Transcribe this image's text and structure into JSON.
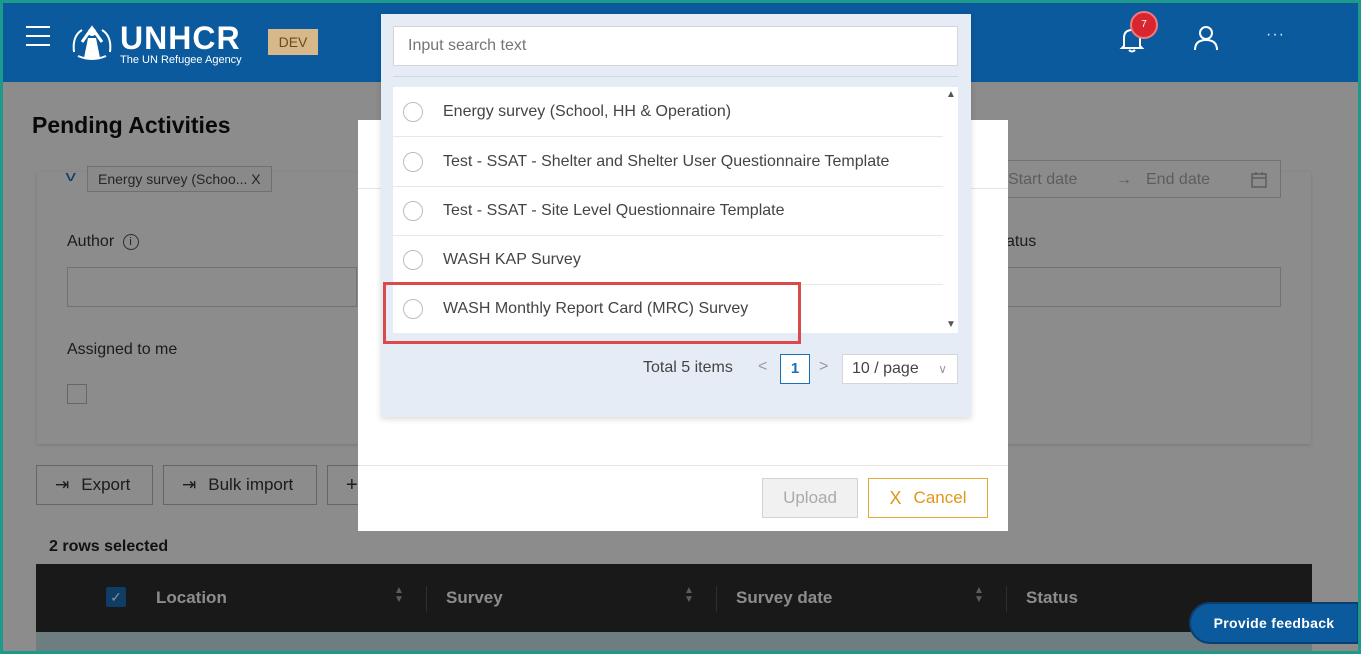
{
  "header": {
    "logo_name": "UNHCR",
    "logo_sub": "The UN Refugee Agency",
    "env_badge": "DEV",
    "notification_count": "7",
    "more_label": "···"
  },
  "page": {
    "title": "Pending Activities",
    "filter_tag": "Energy survey (Schoo...  X",
    "author_label": "Author",
    "status_label": "atus",
    "assigned_label": "Assigned to me",
    "start_date_placeholder": "Start date",
    "end_date_placeholder": "End date",
    "date_arrow": "→"
  },
  "toolbar": {
    "export_label": "Export",
    "bulk_import_label": "Bulk import",
    "add_label": "+"
  },
  "table": {
    "rows_selected": "2 rows selected",
    "columns": [
      "Location",
      "Survey",
      "Survey date",
      "Status"
    ]
  },
  "dropdown": {
    "search_placeholder": "Input search text",
    "items": [
      {
        "label": "Energy survey (School, HH & Operation)"
      },
      {
        "label": "Test - SSAT - Shelter and Shelter User Questionnaire Template"
      },
      {
        "label": "Test - SSAT - Site Level Questionnaire Template"
      },
      {
        "label": "WASH KAP Survey"
      },
      {
        "label": "WASH Monthly Report Card (MRC) Survey"
      }
    ],
    "total_text": "Total 5 items",
    "current_page": "1",
    "page_size": "10 / page",
    "prev": "<",
    "next": ">"
  },
  "modal": {
    "upload_label": "Upload",
    "cancel_label": "Cancel",
    "cancel_icon": "X"
  },
  "feedback": {
    "label": "Provide feedback"
  },
  "colors": {
    "header_bg": "#0b5a9e",
    "accent": "#1a6fb8",
    "cancel": "#e0961a",
    "highlight": "#d94a4a"
  }
}
